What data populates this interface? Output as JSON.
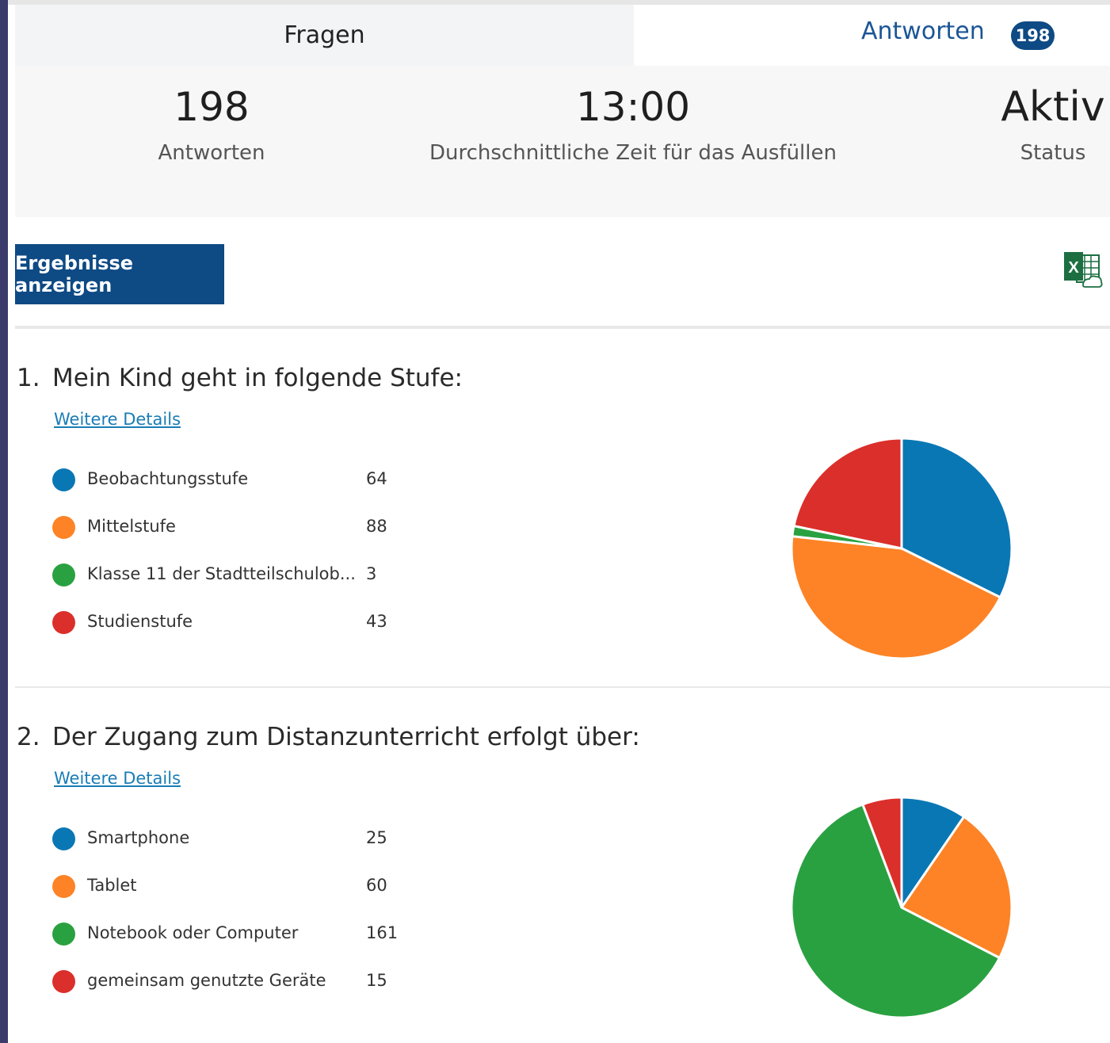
{
  "tabs": {
    "questions_label": "Fragen",
    "responses_label": "Antworten",
    "responses_badge": "198"
  },
  "summary": {
    "responses_value": "198",
    "responses_label": "Antworten",
    "avg_time_value": "13:00",
    "avg_time_label": "Durchschnittliche Zeit für das Ausfüllen",
    "status_value": "Aktiv",
    "status_label": "Status"
  },
  "toolbar": {
    "view_results_label": "Ergebnisse anzeigen",
    "export_icon": "excel-icon"
  },
  "colors": {
    "blue": "#0a77b5",
    "orange": "#fd8326",
    "green": "#2aa141",
    "red": "#db2f2b",
    "accent": "#0e4a84"
  },
  "questions": [
    {
      "number": "1.",
      "title": "Mein Kind geht in folgende Stufe:",
      "details_label": "Weitere Details",
      "options": [
        {
          "label": "Beobachtungsstufe",
          "count": "64",
          "color": "#0a77b5"
        },
        {
          "label": "Mittelstufe",
          "count": "88",
          "color": "#fd8326"
        },
        {
          "label": "Klasse 11 der Stadtteilschulob...",
          "count": "3",
          "color": "#2aa141"
        },
        {
          "label": "Studienstufe",
          "count": "43",
          "color": "#db2f2b"
        }
      ]
    },
    {
      "number": "2.",
      "title": "Der Zugang zum Distanzunterricht erfolgt über:",
      "details_label": "Weitere Details",
      "options": [
        {
          "label": "Smartphone",
          "count": "25",
          "color": "#0a77b5"
        },
        {
          "label": "Tablet",
          "count": "60",
          "color": "#fd8326"
        },
        {
          "label": "Notebook oder Computer",
          "count": "161",
          "color": "#2aa141"
        },
        {
          "label": "gemeinsam genutzte Geräte",
          "count": "15",
          "color": "#db2f2b"
        }
      ]
    }
  ],
  "chart_data": [
    {
      "type": "pie",
      "categories": [
        "Beobachtungsstufe",
        "Mittelstufe",
        "Klasse 11 der Stadtteilschulob...",
        "Studienstufe"
      ],
      "values": [
        64,
        88,
        3,
        43
      ],
      "colors": [
        "#0a77b5",
        "#fd8326",
        "#2aa141",
        "#db2f2b"
      ]
    },
    {
      "type": "pie",
      "categories": [
        "Smartphone",
        "Tablet",
        "Notebook oder Computer",
        "gemeinsam genutzte Geräte"
      ],
      "values": [
        25,
        60,
        161,
        15
      ],
      "colors": [
        "#0a77b5",
        "#fd8326",
        "#2aa141",
        "#db2f2b"
      ]
    }
  ]
}
